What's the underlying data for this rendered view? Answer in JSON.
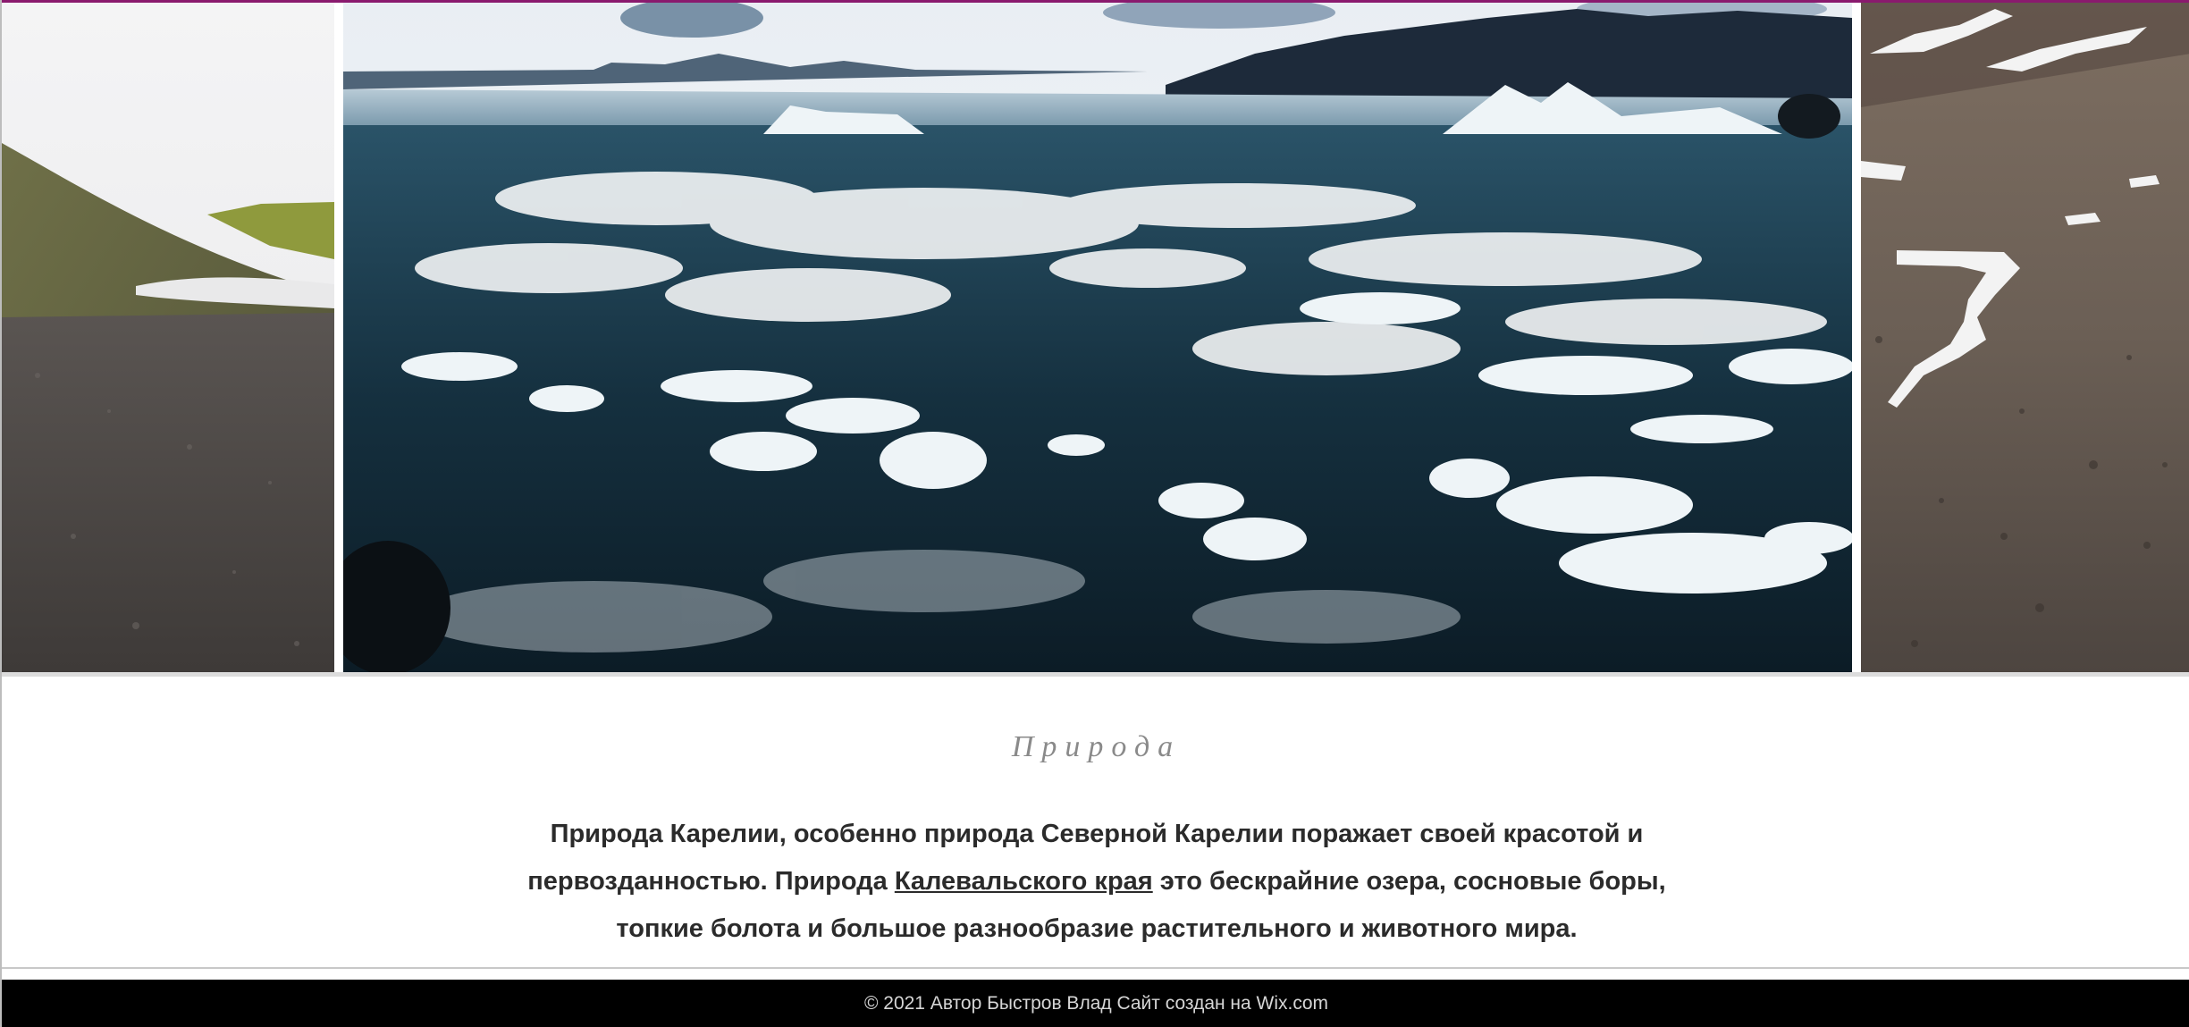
{
  "gallery": {
    "left_image": "mountain-slope-photo",
    "center_image": "glacier-lagoon-ice-photo",
    "right_image": "rocky-hillside-snow-photo"
  },
  "section": {
    "title": "Природа",
    "text_before_link": "Природа Карелии, особенно природа Северной Карелии поражает своей красотой и первозданностью. Природа ",
    "link_text": "Калевальского края",
    "text_after_link": " это бескрайние озера, сосновые боры, топкие болота и большое разнообразие растительного и животного мира."
  },
  "footer": {
    "text": "© 2021 Автор Быстров Влад Сайт создан на Wix.com"
  },
  "colors": {
    "accent": "#8a1a6e",
    "footer_bg": "#000000",
    "title_color": "#8a8a8a",
    "text_color": "#2b2b2b"
  }
}
